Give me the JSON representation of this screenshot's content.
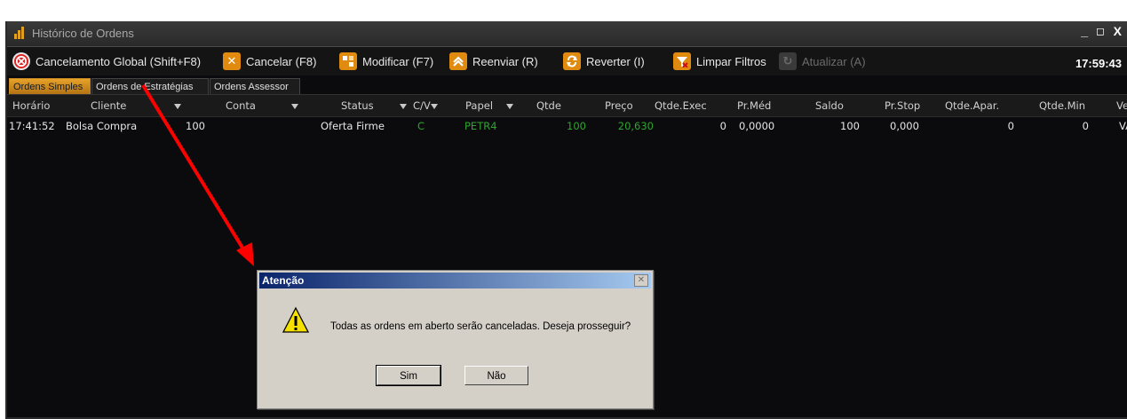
{
  "window": {
    "title": "Histórico de Ordens",
    "controls": {
      "minimize": "_",
      "maximize": "◻",
      "close": "X"
    }
  },
  "toolbar": {
    "buttons": [
      {
        "label": "Cancelamento Global (Shift+F8)",
        "icon": "cancel-all-icon",
        "color": "#e02020"
      },
      {
        "label": "Cancelar (F8)",
        "icon": "close-icon",
        "color": "#e08a10"
      },
      {
        "label": "Modificar (F7)",
        "icon": "edit-icon",
        "color": "#e08a10"
      },
      {
        "label": "Reenviar (R)",
        "icon": "chevron-up-icon",
        "color": "#e08a10"
      },
      {
        "label": "Reverter (I)",
        "icon": "reverse-icon",
        "color": "#e08a10"
      },
      {
        "label": "Limpar Filtros",
        "icon": "clear-filter-icon",
        "color": "#e08a10"
      },
      {
        "label": "Atualizar (A)",
        "icon": "refresh-icon",
        "color": "#555555",
        "disabled": true
      }
    ],
    "clock": "17:59:43"
  },
  "tabs": [
    {
      "label": "Ordens Simples",
      "active": true
    },
    {
      "label": "Ordens de Estratégias",
      "active": false
    },
    {
      "label": "Ordens Assessor",
      "active": false
    }
  ],
  "table": {
    "columns": [
      "Horário",
      "Cliente",
      "Conta",
      "Status",
      "C/V",
      "Papel",
      "Qtde",
      "Preço",
      "Qtde.Exec",
      "Pr.Méd",
      "Saldo",
      "Pr.Stop",
      "Qtde.Apar.",
      "Qtde.Min",
      "Ve"
    ],
    "rows": [
      {
        "horario": "17:41:52",
        "cliente": "Bolsa Compra",
        "conta": "100",
        "status": "Oferta Firme",
        "cv": "C",
        "papel": "PETR4",
        "qtde": "100",
        "preco": "20,630",
        "qtde_exec": "0",
        "pr_med": "0,0000",
        "saldo": "100",
        "pr_stop": "0,000",
        "qtde_apar": "0",
        "qtde_min": "0",
        "ve": "VA"
      }
    ]
  },
  "dialog": {
    "title": "Atenção",
    "close": "✕",
    "message": "Todas as ordens em aberto serão canceladas. Deseja prosseguir?",
    "buttons": {
      "yes": "Sim",
      "no": "Não"
    }
  },
  "colors": {
    "accent": "#e7a22a",
    "annotation_arrow": "#ff0000",
    "buy_green": "#2ea52e"
  }
}
